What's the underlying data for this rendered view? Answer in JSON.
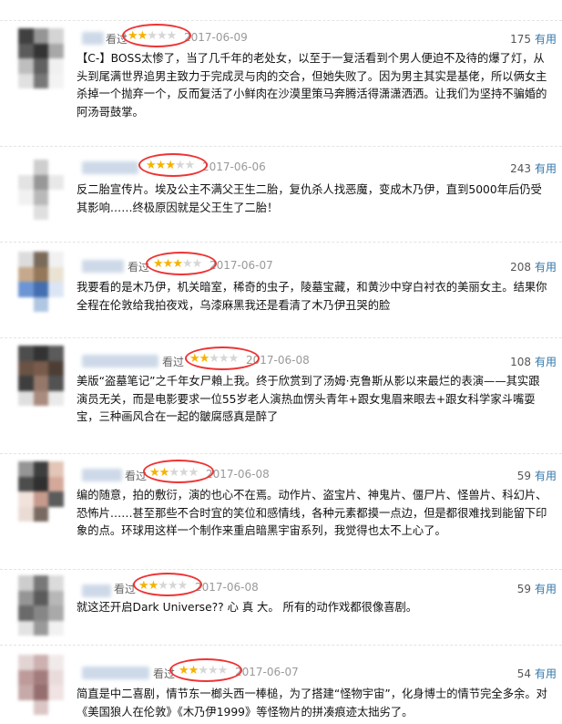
{
  "reviews": [
    {
      "watched": "看过",
      "rating": 2,
      "date": "2017-06-09",
      "votes": "175",
      "useful": "有用",
      "content": "【C-】BOSS太惨了，当了几千年的老处女，以至于一复活看到个男人便迫不及待的爆了灯，从头到尾满世界追男主致力于完成灵与肉的交合，但她失败了。因为男主其实是基佬，所以俩女主杀掉一个抛弃一个，反而复活了小鲜肉在沙漠里策马奔腾活得潇潇洒洒。让我们为坚持不骗婚的阿汤哥鼓掌。",
      "avatar": [
        "#2c2c2c",
        "#8a8a8a",
        "#d0d0d0",
        "#4a4a4a",
        "#1f1f1f",
        "#9f9f9f",
        "#b7b7b7",
        "#505050",
        "#efefef",
        "#dedede",
        "#6a6a6a",
        "#f2f2f2"
      ]
    },
    {
      "watched": "",
      "rating": 3,
      "date": "2017-06-06",
      "votes": "243",
      "useful": "有用",
      "content": "反二胎宣传片。埃及公主不满父王生二胎，复仇杀人找恶魔，变成木乃伊，直到5000年后仍受其影响……终极原因就是父王生了二胎！",
      "avatar": [
        "#ffffff",
        "#c9c9c9",
        "#ffffff",
        "#e0e0e0",
        "#8d8d8d",
        "#e6e6e6",
        "#f0f0f0",
        "#b2b2b2",
        "#ffffff",
        "#ffffff",
        "#dcdcdc",
        "#ffffff"
      ]
    },
    {
      "watched": "看过",
      "rating": 3,
      "date": "2017-06-07",
      "votes": "208",
      "useful": "有用",
      "content": "我要看的是木乃伊，机关暗室，稀奇的虫子，陵墓宝藏，和黄沙中穿白衬衣的美丽女主。结果你全程在伦敦给我拍夜戏，乌漆麻黑我还是看清了木乃伊丑哭的脸",
      "avatar": [
        "#d9d9d9",
        "#6c5a48",
        "#f0f0f0",
        "#c0a080",
        "#8a6a48",
        "#e8e0d0",
        "#5c8ad0",
        "#2f5fa8",
        "#d8e4f4",
        "#ffffff",
        "#a8c0e0",
        "#ffffff"
      ]
    },
    {
      "watched": "看过",
      "rating": 2,
      "date": "2017-06-08",
      "votes": "108",
      "useful": "有用",
      "content": "美版“盗墓笔记”之千年女尸賴上我。终于欣赏到了汤姆·克鲁斯从影以来最烂的表演——其实跟演员无关，而是电影要求一位55岁老人演热血愣头青年+跟女鬼眉来眼去+跟女科学家斗嘴耍宝，三种画风合在一起的皺腐感真是醉了",
      "avatar": [
        "#3a3a3a",
        "#1e1e1e",
        "#4a4a4a",
        "#5a4030",
        "#6a4a38",
        "#3a2a20",
        "#2a2a2a",
        "#8a6a5a",
        "#404040",
        "#dcdcdc",
        "#a08070",
        "#e8e8e8"
      ]
    },
    {
      "watched": "看过",
      "rating": 2,
      "date": "2017-06-08",
      "votes": "59",
      "useful": "有用",
      "content": "编的随意，拍的敷衍，演的也心不在焉。动作片、盗宝片、神鬼片、僵尸片、怪兽片、科幻片、恐怖片……甚至那些不合时宜的笑位和感情线，各种元素都摸一点边，但是都很难找到能留下印象的点。环球用这样一个制作来重启暗黑宇宙系列，我觉得也太不上心了。",
      "avatar": [
        "#8a8a8a",
        "#2a2a2a",
        "#e0c0b0",
        "#3a3a3a",
        "#1a1a1a",
        "#d0a090",
        "#f0e0d8",
        "#c09080",
        "#4a4a4a",
        "#e8d8d0",
        "#6a5a50",
        "#ffffff"
      ]
    },
    {
      "watched": "看过",
      "rating": 2,
      "date": "2017-06-08",
      "votes": "59",
      "useful": "有用",
      "content": "就这还开启Dark Universe?? 心 真 大。 所有的动作戏都很像喜剧。",
      "avatar": [
        "#c8c8c8",
        "#6a6a6a",
        "#d8d8d8",
        "#8a8a8a",
        "#4a4a4a",
        "#b0b0b0",
        "#5a5a5a",
        "#7a7a7a",
        "#a0a0a0",
        "#e0e0e0",
        "#909090",
        "#f0f0f0"
      ]
    },
    {
      "watched": "看过",
      "rating": 2,
      "date": "2017-06-07",
      "votes": "54",
      "useful": "有用",
      "content": "简直是中二喜剧，情节东一榔头西一棒槌，为了搭建“怪物宇宙”，化身博士的情节完全多余。对《美国狼人在伦敦》《木乃伊1999》等怪物片的拼凑痕迹太拙劣了。",
      "avatar": [
        "#e0d0d0",
        "#c8a8a8",
        "#f0e8e8",
        "#b89090",
        "#9a7070",
        "#e8d8d8",
        "#c0a0a0",
        "#8a6060",
        "#f0e0e0",
        "#ffffff",
        "#d8c0c0",
        "#ffffff"
      ]
    }
  ],
  "colors": {
    "star_on": "#f6b200",
    "star_off": "#d6d6d6",
    "annotation_circle": "#e33333",
    "useful_link": "#3377aa"
  },
  "icons": {
    "star": "star-icon"
  }
}
